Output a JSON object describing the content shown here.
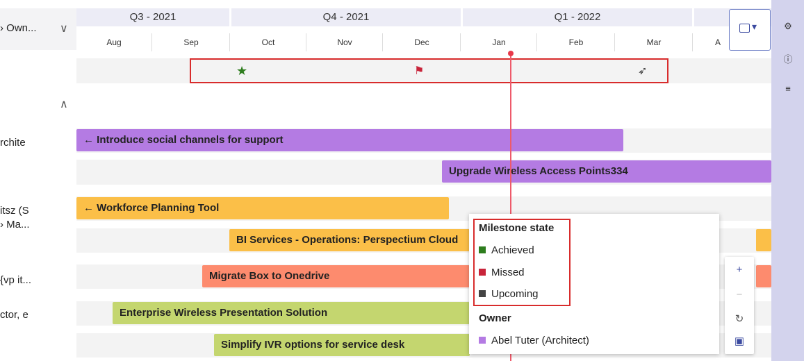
{
  "group": {
    "header_label": "› Own...",
    "chevron": "chevron-down-icon",
    "collapse_chevron": "chevron-up-icon"
  },
  "timeline": {
    "quarters": [
      "Q3 - 2021",
      "Q4 - 2021",
      "Q1 - 2022"
    ],
    "months": [
      "Aug",
      "Sep",
      "Oct",
      "Nov",
      "Dec",
      "Jan",
      "Feb",
      "Mar",
      "A"
    ]
  },
  "left_labels": [
    "rchite",
    "itsz (S",
    "› Ma...",
    "{vp it...",
    "ctor, e"
  ],
  "milestones": [
    {
      "icon": "star-icon",
      "symbol": "★",
      "color": "#2e7d1e"
    },
    {
      "icon": "flag-icon",
      "symbol": "⚑",
      "color": "#c8243a"
    },
    {
      "icon": "rocket-icon",
      "symbol": "➶",
      "color": "#333333"
    }
  ],
  "bars": [
    {
      "label": "← Introduce social channels for support",
      "color": "#b47be3"
    },
    {
      "label": "Upgrade Wireless Access Points334",
      "color": "#b47be3"
    },
    {
      "label": "← Workforce Planning Tool",
      "color": "#fbbf48"
    },
    {
      "label": "BI Services - Operations: Perspectium Cloud",
      "color": "#fbbf48"
    },
    {
      "label": "Migrate Box to Onedrive",
      "color": "#fd8b6e"
    },
    {
      "label": "Enterprise Wireless Presentation Solution",
      "color": "#c4d66f"
    },
    {
      "label": "Simplify IVR options for service desk",
      "color": "#c4d66f"
    }
  ],
  "legend": {
    "milestone_title": "Milestone state",
    "milestone_items": [
      {
        "label": "Achieved",
        "color": "#2e7d1e"
      },
      {
        "label": "Missed",
        "color": "#c8243a"
      },
      {
        "label": "Upcoming",
        "color": "#444444"
      }
    ],
    "owner_title": "Owner",
    "owner_items": [
      {
        "label": "Abel Tuter (Architect)",
        "color": "#b47be3"
      }
    ]
  },
  "zoom": {
    "plus": "+",
    "minus": "−",
    "reset": "↻",
    "legend_toggle": "▣"
  },
  "sidebar_icons": [
    "gear-icon",
    "info-icon",
    "list-icon"
  ],
  "view_button": {
    "icon": "calendar-icon",
    "caret": "▾"
  }
}
